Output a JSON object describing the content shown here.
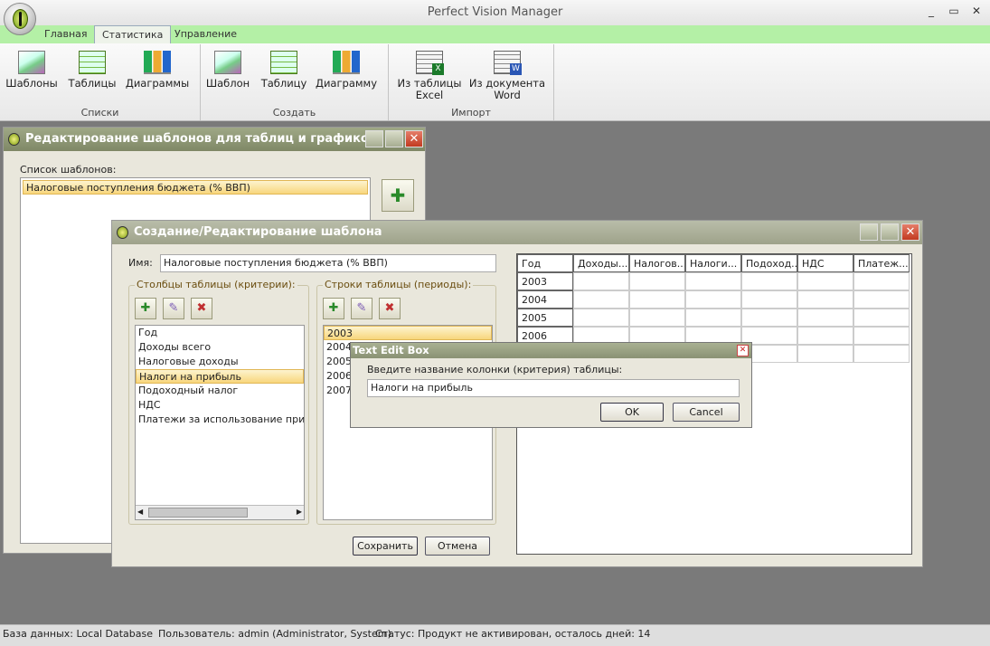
{
  "app": {
    "title": "Perfect Vision Manager",
    "controls": {
      "minimize": "_",
      "maximize": "▭",
      "close": "✕"
    }
  },
  "ribbon": {
    "tabs": [
      "Главная",
      "Статистика",
      "Управление"
    ],
    "groups": [
      {
        "label": "Списки",
        "buttons": [
          "Шаблоны",
          "Таблицы",
          "Диаграммы"
        ]
      },
      {
        "label": "Создать",
        "buttons": [
          "Шаблон",
          "Таблицу",
          "Диаграмму"
        ]
      },
      {
        "label": "Импорт",
        "buttons": [
          "Из таблицы\nExcel",
          "Из документа\nWord"
        ]
      }
    ]
  },
  "templates_dialog": {
    "title": "Редактирование шаблонов для таблиц и графиков",
    "list_label": "Список шаблонов:",
    "items": [
      "Налоговые поступления бюджета (% ВВП)"
    ]
  },
  "editor_dialog": {
    "title": "Создание/Редактирование шаблона",
    "name_label": "Имя:",
    "name_value": "Налоговые поступления бюджета (% ВВП)",
    "columns_legend": "Столбцы таблицы (критерии):",
    "columns": [
      "Год",
      "Доходы всего",
      "Налоговые доходы",
      "Налоги на прибыль",
      "Подоходный налог",
      "НДС",
      "Платежи за использование природн"
    ],
    "rows_legend": "Строки таблицы (периоды):",
    "rows": [
      "2003",
      "2004",
      "2005",
      "2006",
      "2007"
    ],
    "save_label": "Сохранить",
    "cancel_label": "Отмена",
    "grid_headers": [
      "Год",
      "Доходы...",
      "Налогов...",
      "Налоги...",
      "Подоход...",
      "НДС",
      "Платеж..."
    ],
    "grid_rows": [
      "2003",
      "2004",
      "2005",
      "2006",
      ""
    ]
  },
  "text_edit_box": {
    "title": "Text Edit Box",
    "prompt": "Введите название колонки (критерия) таблицы:",
    "value": "Налоги на прибыль",
    "ok_label": "OK",
    "cancel_label": "Cancel",
    "close": "✕"
  },
  "status": {
    "database": "База данных: Local Database",
    "user": "Пользователь: admin (Administrator, System).",
    "state": "Статус: Продукт не активирован, осталось дней: 14"
  }
}
